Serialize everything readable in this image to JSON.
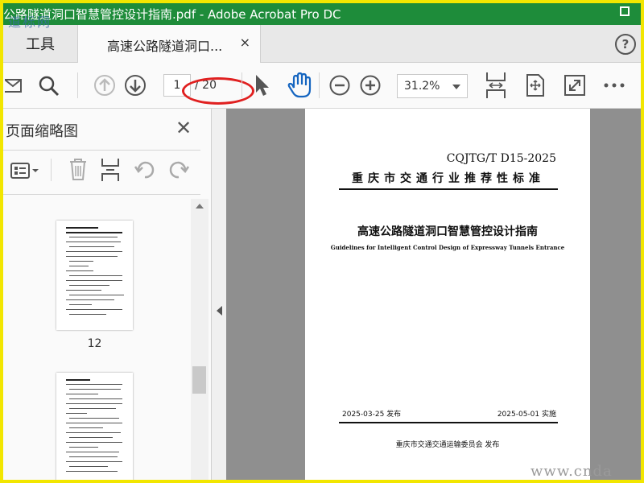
{
  "window": {
    "title": "公路隧道洞口智慧管控设计指南.pdf - Adobe Acrobat Pro DC"
  },
  "watermarks": {
    "top_left": "道标网",
    "bottom_right": "www.cnda"
  },
  "tabs": {
    "tools": "工具",
    "document": "高速公路隧道洞口...",
    "close": "×"
  },
  "toolbar": {
    "current_page": "1",
    "total_pages": "/ 20",
    "zoom": "31.2%"
  },
  "sidebar": {
    "title": "页面缩略图",
    "close": "✕",
    "thumbnails": [
      {
        "label": "12"
      },
      {
        "label": ""
      }
    ]
  },
  "document": {
    "standard_code": "CQJTG/T  D15-2025",
    "organization": "重庆市交通行业推荐性标准",
    "title": "高速公路隧道洞口智慧管控设计指南",
    "subtitle": "Guidelines for Intelligent Control Design of Expressway Tunnels Entrance",
    "issue_date": "2025-03-25 发布",
    "implementation_date": "2025-05-01 实施",
    "publisher": "重庆市交通交通运输委员会    发布"
  },
  "colors": {
    "titlebar": "#1e8c3a",
    "frame": "#f2e600",
    "annotation": "#e02020",
    "hand_tool": "#1565c0"
  }
}
